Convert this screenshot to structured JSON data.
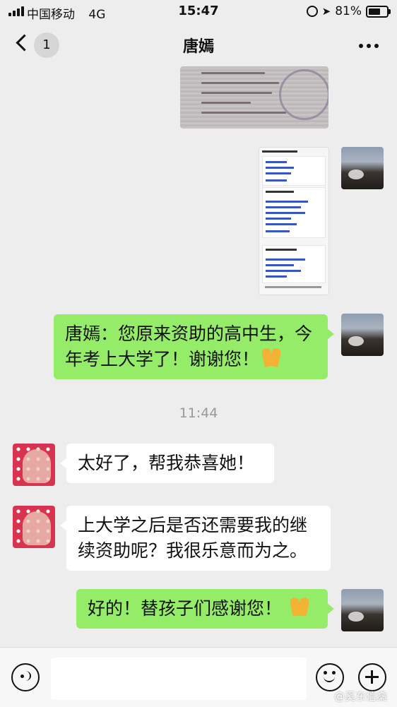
{
  "status_bar": {
    "carrier": "中国移动",
    "network": "4G",
    "time": "15:47",
    "battery": "81%",
    "battery_level": 0.81
  },
  "nav": {
    "unread_count": "1",
    "title": "唐嫣"
  },
  "messages": [
    {
      "from": "me",
      "text": "唐嫣：您原来资助的高中生，今年考上大学了！谢谢您！",
      "emoji": "pray-icon"
    },
    {
      "from": "other",
      "text": "太好了，帮我恭喜她！"
    },
    {
      "from": "other",
      "text": "上大学之后是否还需要我的继续资助呢？我很乐意而为之。"
    },
    {
      "from": "me",
      "text": "好的！替孩子们感谢您！",
      "emoji": "pray-icon"
    }
  ],
  "timestamp": "11:44",
  "watermark": "@奚东信燊",
  "colors": {
    "background": "#ededed",
    "outgoing_bubble": "#95ec69",
    "incoming_bubble": "#ffffff"
  }
}
